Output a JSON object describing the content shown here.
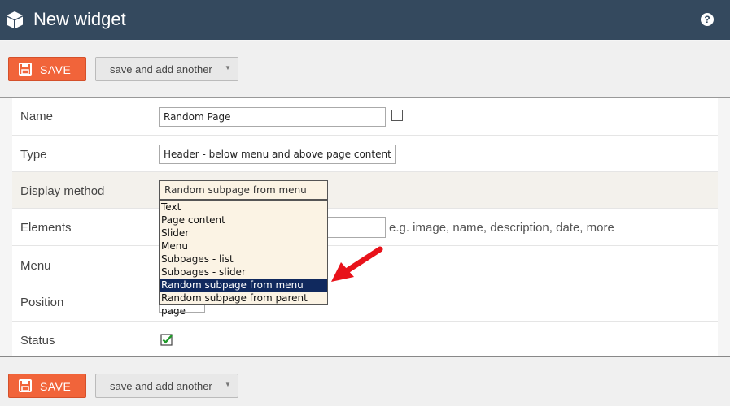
{
  "header": {
    "title": "New widget",
    "help_label": "?",
    "icon": "cube-icon"
  },
  "toolbar": {
    "save_label": "SAVE",
    "save_add_label": "save and add another"
  },
  "form": {
    "name": {
      "label": "Name",
      "value": "Random Page"
    },
    "type": {
      "label": "Type",
      "value": "Header - below menu and above page content"
    },
    "display_method": {
      "label": "Display method",
      "value": "Random subpage from menu",
      "options": [
        "Text",
        "Page content",
        "Slider",
        "Menu",
        "Subpages - list",
        "Subpages - slider",
        "Random subpage from menu",
        "Random subpage from parent page"
      ],
      "selected_index": 6
    },
    "elements": {
      "label": "Elements",
      "hint": "e.g. image, name, description, date, more"
    },
    "menu": {
      "label": "Menu"
    },
    "position": {
      "label": "Position"
    },
    "status": {
      "label": "Status",
      "checked": true
    }
  },
  "colors": {
    "header_bg": "#34495e",
    "save_bg": "#f1643a",
    "dropdown_bg": "#fbf3e4",
    "selected_option_bg": "#10295e",
    "arrow": "#e8121a"
  }
}
